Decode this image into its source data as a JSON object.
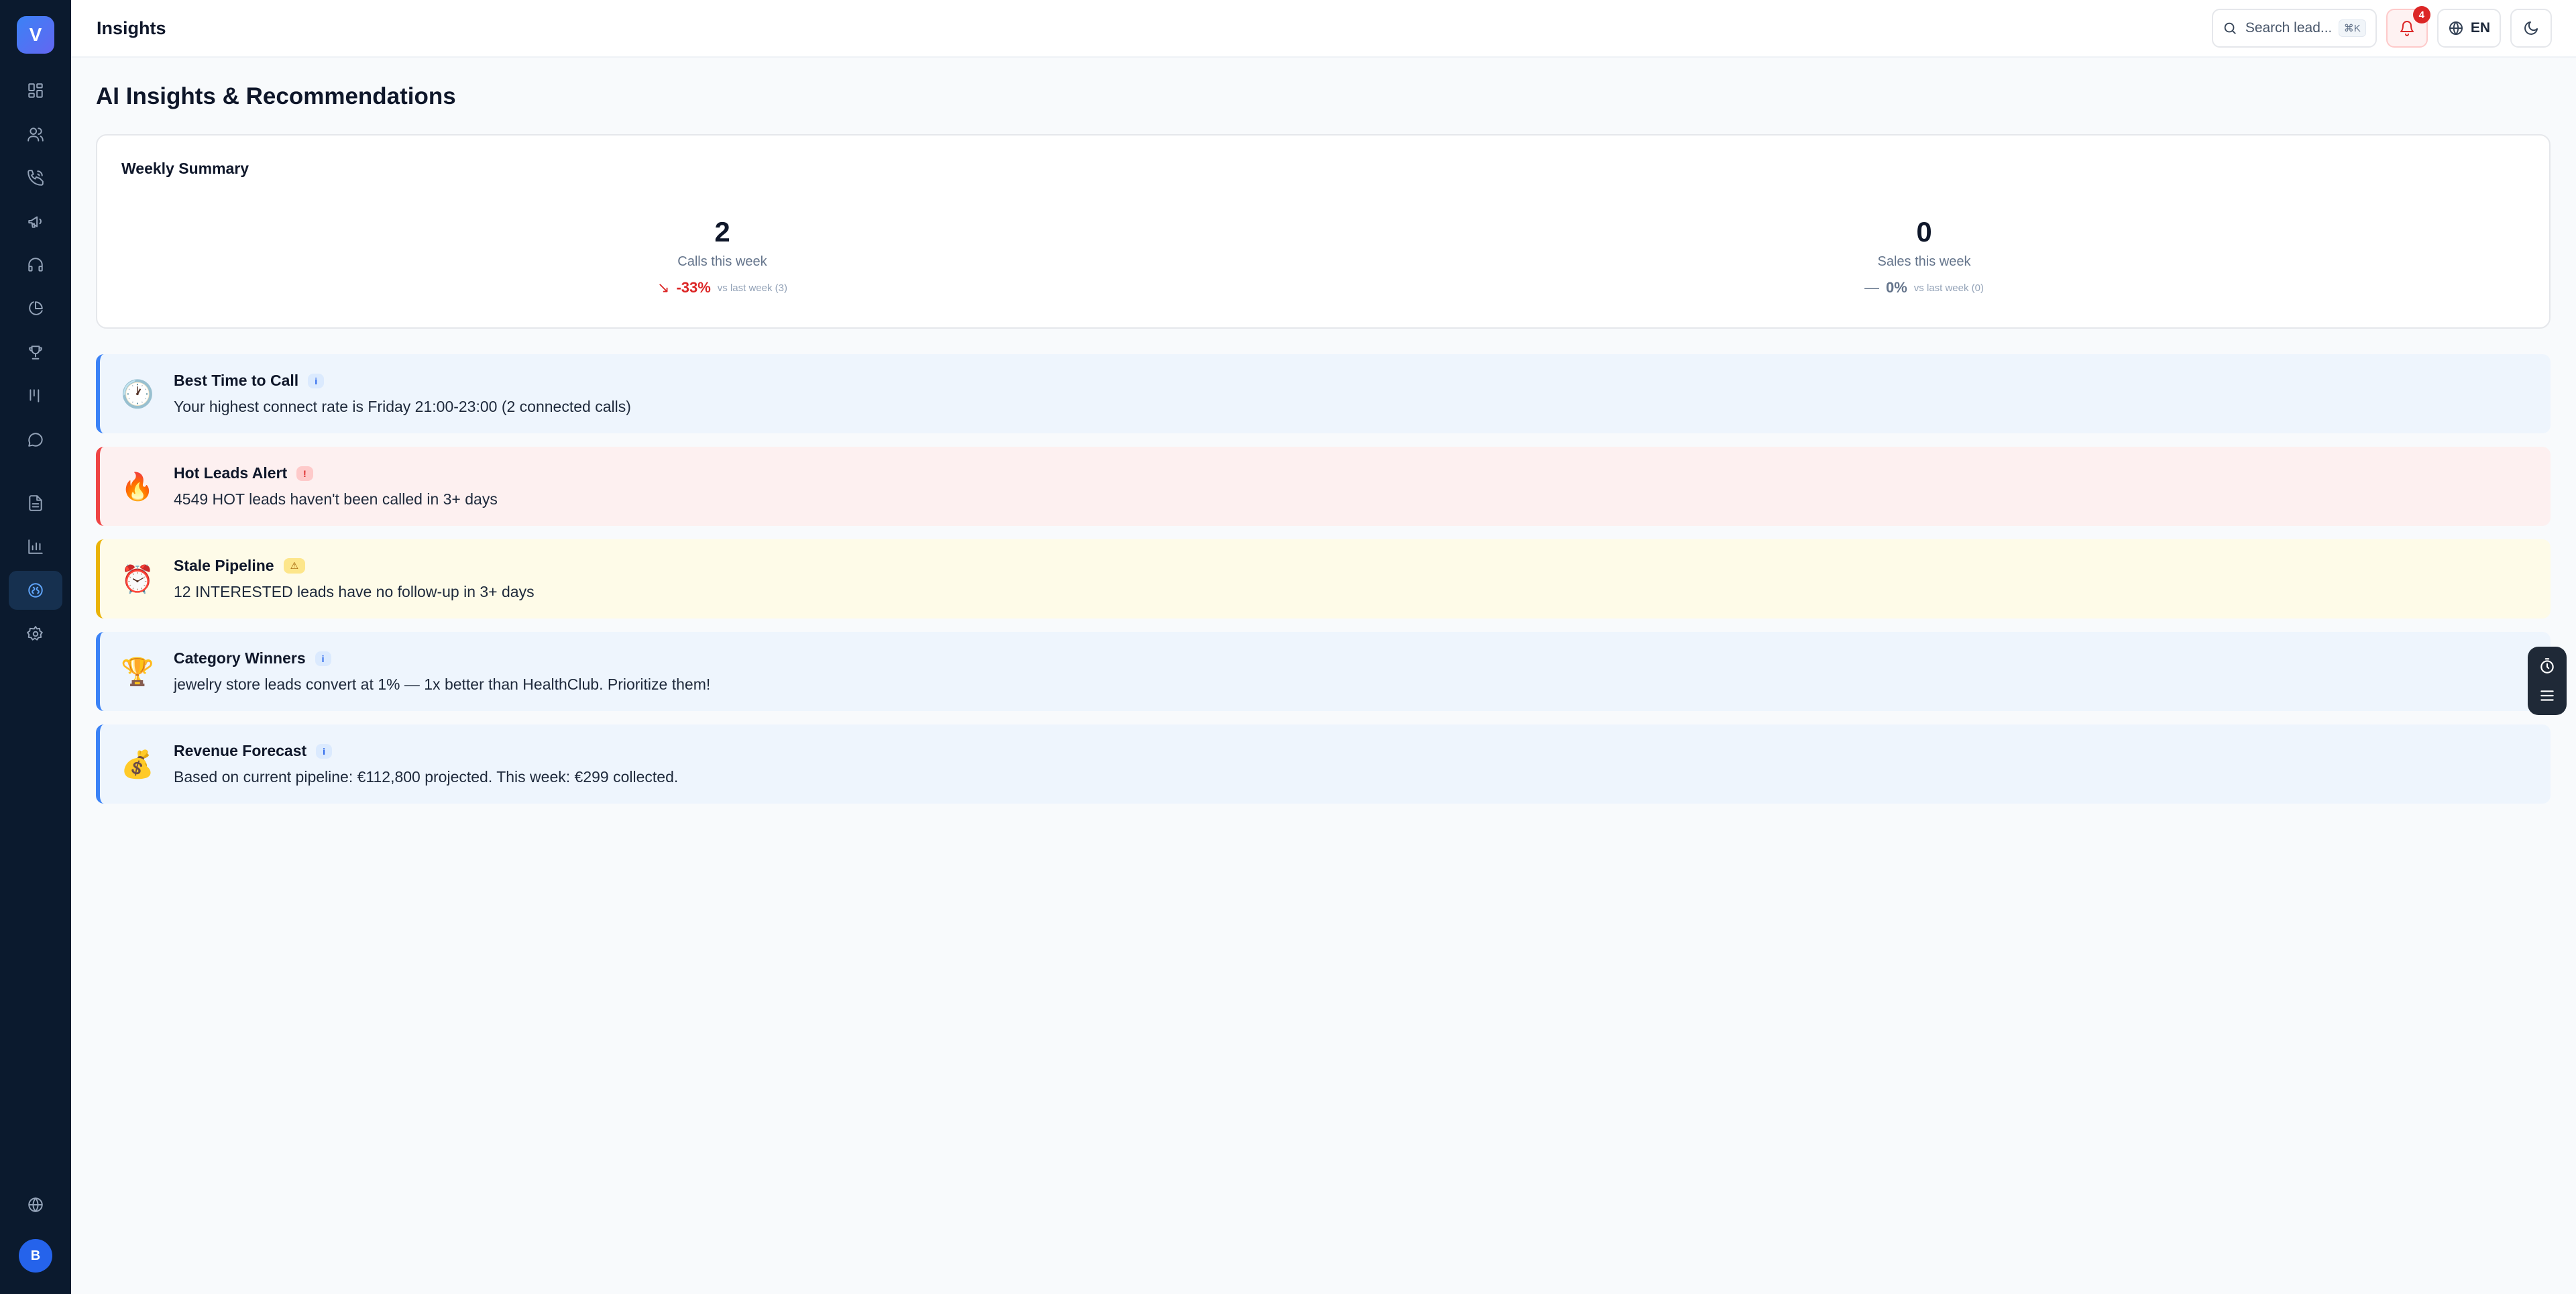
{
  "app": {
    "logo_letter": "V",
    "user_initial": "B"
  },
  "sidebar": {
    "items": [
      {
        "icon": "dashboard-icon",
        "active": false
      },
      {
        "icon": "users-icon",
        "active": false
      },
      {
        "icon": "phone-icon",
        "active": false
      },
      {
        "icon": "megaphone-icon",
        "active": false
      },
      {
        "icon": "headset-icon",
        "active": false
      },
      {
        "icon": "pie-chart-icon",
        "active": false
      },
      {
        "icon": "trophy-icon",
        "active": false
      },
      {
        "icon": "kanban-icon",
        "active": false
      },
      {
        "icon": "chat-icon",
        "active": false
      },
      {
        "icon": "document-icon",
        "active": false
      },
      {
        "icon": "bar-chart-icon",
        "active": false
      },
      {
        "icon": "insights-icon",
        "active": true
      },
      {
        "icon": "gear-icon",
        "active": false
      }
    ],
    "bottom_icon": "globe-icon"
  },
  "header": {
    "title": "Insights",
    "search_placeholder": "Search lead...",
    "search_shortcut": "⌘K",
    "notification_count": "4",
    "language": "EN"
  },
  "page": {
    "title": "AI Insights & Recommendations"
  },
  "summary": {
    "title": "Weekly Summary",
    "stats": [
      {
        "value": "2",
        "label": "Calls this week",
        "trend_icon": "↘",
        "trend_pct": "-33%",
        "vs": "vs last week (3)",
        "direction": "down"
      },
      {
        "value": "0",
        "label": "Sales this week",
        "trend_icon": "—",
        "trend_pct": "0%",
        "vs": "vs last week (0)",
        "direction": "flat"
      }
    ]
  },
  "insights": [
    {
      "emoji": "🕐",
      "title": "Best Time to Call",
      "pill": "i",
      "text": "Your highest connect rate is Friday 21:00-23:00 (2 connected calls)",
      "type": "info"
    },
    {
      "emoji": "🔥",
      "title": "Hot Leads Alert",
      "pill": "!",
      "text": "4549 HOT leads haven't been called in 3+ days",
      "type": "danger"
    },
    {
      "emoji": "⏰",
      "title": "Stale Pipeline",
      "pill": "⚠",
      "text": "12 INTERESTED leads have no follow-up in 3+ days",
      "type": "warn"
    },
    {
      "emoji": "🏆",
      "title": "Category Winners",
      "pill": "i",
      "text": "jewelry store leads convert at 1% — 1x better than HealthClub. Prioritize them!",
      "type": "info"
    },
    {
      "emoji": "💰",
      "title": "Revenue Forecast",
      "pill": "i",
      "text": "Based on current pipeline: €112,800 projected. This week: €299 collected.",
      "type": "info"
    }
  ]
}
